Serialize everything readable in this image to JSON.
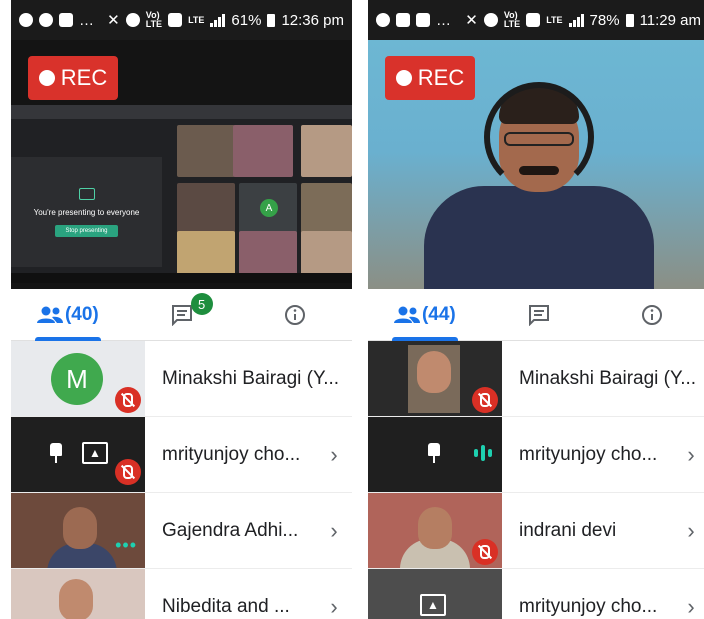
{
  "colors": {
    "accent": "#1a73e8",
    "rec": "#d9322b",
    "mic_muted": "#d93025",
    "badge": "#1e8e3e",
    "avatar_green": "#40a94e"
  },
  "left": {
    "status": {
      "battery": "61%",
      "time": "12:36 pm",
      "icons": [
        "whatsapp-icon",
        "chrome-icon",
        "message-icon",
        "mute-icon",
        "alarm-icon",
        "signal-icon",
        "battery-icon"
      ]
    },
    "rec_label": "REC",
    "presenting_text": "You're presenting to everyone",
    "stop_presenting": "Stop presenting",
    "tile_avatar_letter": "A",
    "people_count": "(40)",
    "chat_badge": "5",
    "participants": [
      {
        "name": "Minakshi Bairagi (Y...",
        "avatar": "M",
        "muted": true
      },
      {
        "name": "mrityunjoy cho...",
        "muted": true
      },
      {
        "name": "Gajendra Adhi..."
      },
      {
        "name": "Nibedita and ..."
      }
    ]
  },
  "right": {
    "status": {
      "battery": "78%",
      "time": "11:29 am",
      "icons": [
        "whatsapp-icon",
        "message-icon",
        "mute-icon",
        "alarm-icon",
        "signal-icon",
        "battery-icon"
      ]
    },
    "rec_label": "REC",
    "people_count": "(44)",
    "participants": [
      {
        "name": "Minakshi Bairagi (Y...",
        "muted": true
      },
      {
        "name": "mrityunjoy cho..."
      },
      {
        "name": "indrani devi",
        "muted": true
      },
      {
        "name": "mrityunjoy cho..."
      }
    ]
  }
}
